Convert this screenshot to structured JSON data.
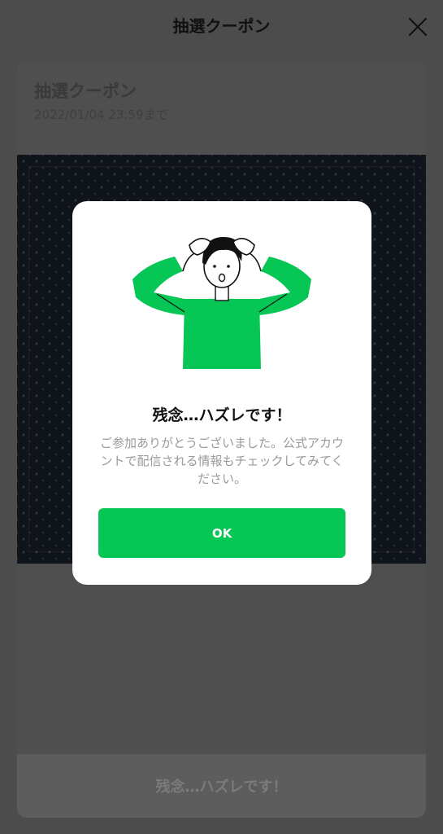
{
  "header": {
    "title": "抽選クーポン",
    "close_icon": "close-icon"
  },
  "card": {
    "title": "抽選クーポン",
    "expiry": "2022/01/04 23:59まで",
    "bottom_button_label": "残念…ハズレです！"
  },
  "modal": {
    "illustration": "person-holding-head-illustration",
    "title": "残念…ハズレです！",
    "message": "ご参加ありがとうございました。公式アカウントで配信される情報もチェックしてみてください。",
    "ok_label": "OK"
  },
  "colors": {
    "accent_green": "#06c755",
    "overlay": "#4c4c4c"
  }
}
